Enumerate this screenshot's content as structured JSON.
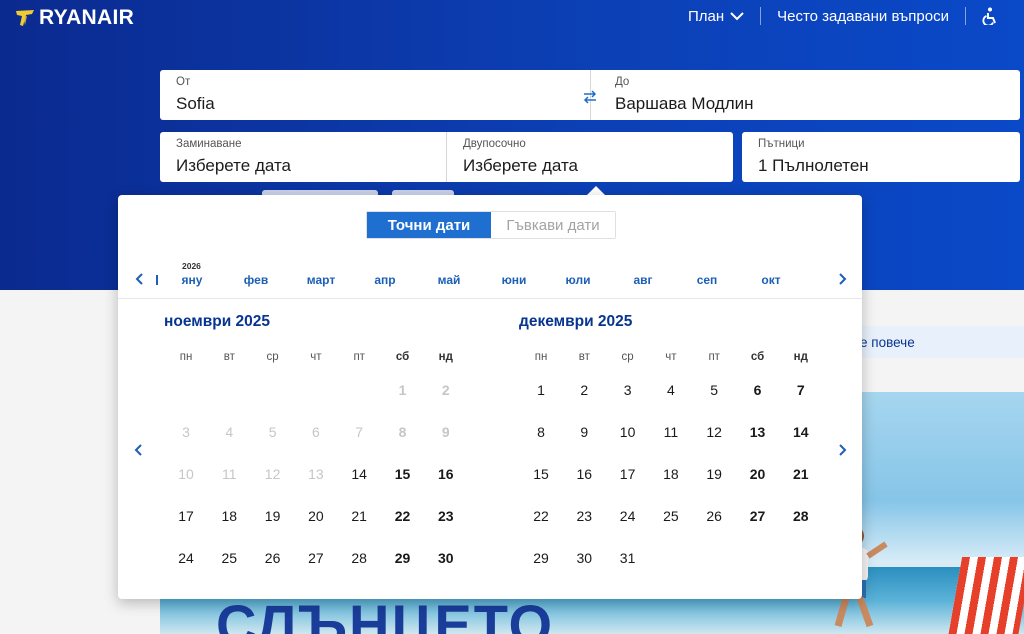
{
  "brand": {
    "name": "RYANAIR"
  },
  "nav": {
    "plan": "План",
    "faq": "Често задавани въпроси",
    "accessibility_icon": "accessibility-icon"
  },
  "search": {
    "from_label": "От",
    "from_value": "Sofia",
    "to_label": "До",
    "to_value": "Варшава Модлин",
    "depart_label": "Заминаване",
    "depart_value": "Изберете дата",
    "return_label": "Двупосочно",
    "return_value": "Изберете дата",
    "pax_label": "Пътници",
    "pax_value": "1 Пълнолетен"
  },
  "calendar": {
    "toggle_exact": "Точни дати",
    "toggle_flexible": "Гъвкави дати",
    "year_marker": "2026",
    "months_bar": [
      "яну",
      "фев",
      "март",
      "апр",
      "май",
      "юни",
      "юли",
      "авг",
      "сеп",
      "окт"
    ],
    "weekdays": [
      "пн",
      "вт",
      "ср",
      "чт",
      "пт",
      "сб",
      "нд"
    ],
    "left": {
      "title": "ноември 2025",
      "weeks": [
        [
          [
            "",
            0
          ],
          [
            "",
            0
          ],
          [
            "",
            0
          ],
          [
            "",
            0
          ],
          [
            "",
            0
          ],
          [
            "1",
            1
          ],
          [
            "2",
            1
          ]
        ],
        [
          [
            "3",
            1
          ],
          [
            "4",
            1
          ],
          [
            "5",
            1
          ],
          [
            "6",
            1
          ],
          [
            "7",
            1
          ],
          [
            "8",
            1
          ],
          [
            "9",
            1
          ]
        ],
        [
          [
            "10",
            1
          ],
          [
            "11",
            1
          ],
          [
            "12",
            1
          ],
          [
            "13",
            1
          ],
          [
            "14",
            0
          ],
          [
            "15",
            0
          ],
          [
            "16",
            0
          ]
        ],
        [
          [
            "17",
            0
          ],
          [
            "18",
            0
          ],
          [
            "19",
            0
          ],
          [
            "20",
            0
          ],
          [
            "21",
            0
          ],
          [
            "22",
            0
          ],
          [
            "23",
            0
          ]
        ],
        [
          [
            "24",
            0
          ],
          [
            "25",
            0
          ],
          [
            "26",
            0
          ],
          [
            "27",
            0
          ],
          [
            "28",
            0
          ],
          [
            "29",
            0
          ],
          [
            "30",
            0
          ]
        ]
      ]
    },
    "right": {
      "title": "декември 2025",
      "weeks": [
        [
          [
            "1",
            0
          ],
          [
            "2",
            0
          ],
          [
            "3",
            0
          ],
          [
            "4",
            0
          ],
          [
            "5",
            0
          ],
          [
            "6",
            0
          ],
          [
            "7",
            0
          ]
        ],
        [
          [
            "8",
            0
          ],
          [
            "9",
            0
          ],
          [
            "10",
            0
          ],
          [
            "11",
            0
          ],
          [
            "12",
            0
          ],
          [
            "13",
            0
          ],
          [
            "14",
            0
          ]
        ],
        [
          [
            "15",
            0
          ],
          [
            "16",
            0
          ],
          [
            "17",
            0
          ],
          [
            "18",
            0
          ],
          [
            "19",
            0
          ],
          [
            "20",
            0
          ],
          [
            "21",
            0
          ]
        ],
        [
          [
            "22",
            0
          ],
          [
            "23",
            0
          ],
          [
            "24",
            0
          ],
          [
            "25",
            0
          ],
          [
            "26",
            0
          ],
          [
            "27",
            0
          ],
          [
            "28",
            0
          ]
        ],
        [
          [
            "29",
            0
          ],
          [
            "30",
            0
          ],
          [
            "31",
            0
          ],
          [
            "",
            0
          ],
          [
            "",
            0
          ],
          [
            "",
            0
          ],
          [
            "",
            0
          ]
        ]
      ]
    }
  },
  "promo": {
    "partial_text": "е повече"
  },
  "hero": {
    "partial_text": "СЛЪНЦЕТО"
  }
}
